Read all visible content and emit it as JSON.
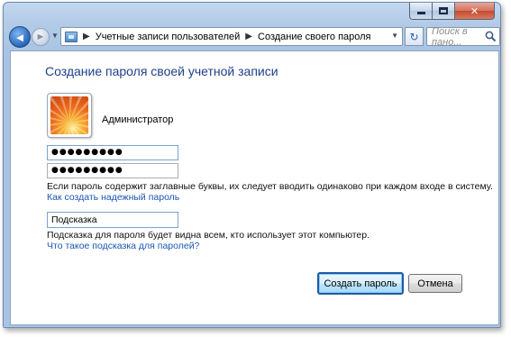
{
  "window": {
    "caption_buttons": [
      "minimize-icon",
      "maximize-icon",
      "close-icon"
    ],
    "close_glyph": "✕"
  },
  "nav": {
    "back_glyph": "◄",
    "forward_glyph": "►",
    "breadcrumbs": [
      "Учетные записи пользователей",
      "Создание своего пароля"
    ],
    "separator": "▶",
    "refresh_glyph": "↻",
    "search_placeholder": "Поиск в пано..."
  },
  "content": {
    "title": "Создание пароля своей учетной записи",
    "username": "Администратор",
    "password_value": "●●●●●●●●●",
    "confirm_value": "●●●●●●●●●",
    "case_note": "Если пароль содержит заглавные буквы, их следует вводить одинаково при каждом входе в систему.",
    "strong_password_link": "Как создать надежный пароль",
    "hint_value": "Подсказка",
    "hint_note": "Подсказка для пароля будет видна всем, кто использует этот компьютер.",
    "hint_help_link": "Что такое подсказка для паролей?",
    "create_button": "Создать пароль",
    "cancel_button": "Отмена"
  },
  "colors": {
    "title": "#1e3f8a",
    "link": "#1a56b3",
    "frame": "#a9c4e3",
    "close_button": "#c44a30"
  }
}
